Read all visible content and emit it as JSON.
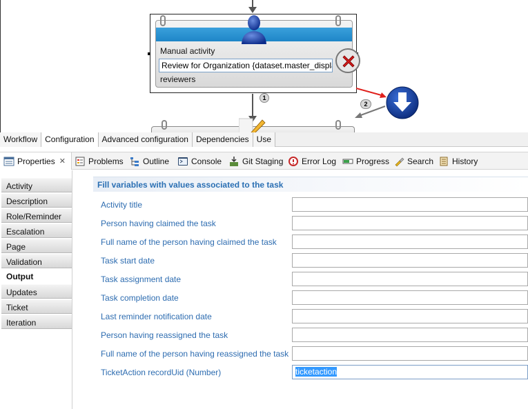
{
  "diagram": {
    "node": {
      "title": "Manual activity",
      "field_value": "Review for Organization {dataset.master_displa",
      "participants_label": "reviewers"
    },
    "badges": [
      "1",
      "2"
    ],
    "icons": {
      "user": "user-icon",
      "delete": "delete-icon",
      "next": "arrow-down-icon",
      "edit": "pencil-icon"
    },
    "colors": {
      "band": "#1e86c8",
      "transition": "#e0201c"
    }
  },
  "editor_tabs": [
    {
      "label": "Workflow",
      "active": false
    },
    {
      "label": "Configuration",
      "active": true
    },
    {
      "label": "Advanced configuration",
      "active": false
    },
    {
      "label": "Dependencies",
      "active": false
    },
    {
      "label": "Use",
      "active": false
    }
  ],
  "views": [
    {
      "label": "Properties",
      "icon": "properties-icon",
      "active": true
    },
    {
      "label": "Problems",
      "icon": "problems-icon"
    },
    {
      "label": "Outline",
      "icon": "outline-icon"
    },
    {
      "label": "Console",
      "icon": "console-icon"
    },
    {
      "label": "Git Staging",
      "icon": "git-staging-icon"
    },
    {
      "label": "Error Log",
      "icon": "error-log-icon"
    },
    {
      "label": "Progress",
      "icon": "progress-icon"
    },
    {
      "label": "Search",
      "icon": "search-icon"
    },
    {
      "label": "History",
      "icon": "history-icon"
    }
  ],
  "nav": [
    {
      "label": "Activity"
    },
    {
      "label": "Description"
    },
    {
      "label": "Role/Reminder"
    },
    {
      "label": "Escalation"
    },
    {
      "label": "Page"
    },
    {
      "label": "Validation"
    },
    {
      "label": "Output",
      "active": true
    },
    {
      "label": "Updates"
    },
    {
      "label": "Ticket"
    },
    {
      "label": "Iteration"
    }
  ],
  "form": {
    "header": "Fill variables with values associated to the task",
    "fields": [
      {
        "label": "Activity title",
        "value": ""
      },
      {
        "label": "Person having claimed the task",
        "value": ""
      },
      {
        "label": "Full name of the person having claimed the task",
        "value": ""
      },
      {
        "label": "Task start date",
        "value": ""
      },
      {
        "label": "Task assignment date",
        "value": ""
      },
      {
        "label": "Task completion date",
        "value": ""
      },
      {
        "label": "Last reminder notification date",
        "value": ""
      },
      {
        "label": "Person having reassigned the task",
        "value": ""
      },
      {
        "label": "Full name of the person having reassigned the task",
        "value": ""
      },
      {
        "label": "TicketAction recordUid (Number)",
        "value": "ticketaction",
        "selected": true
      }
    ]
  }
}
